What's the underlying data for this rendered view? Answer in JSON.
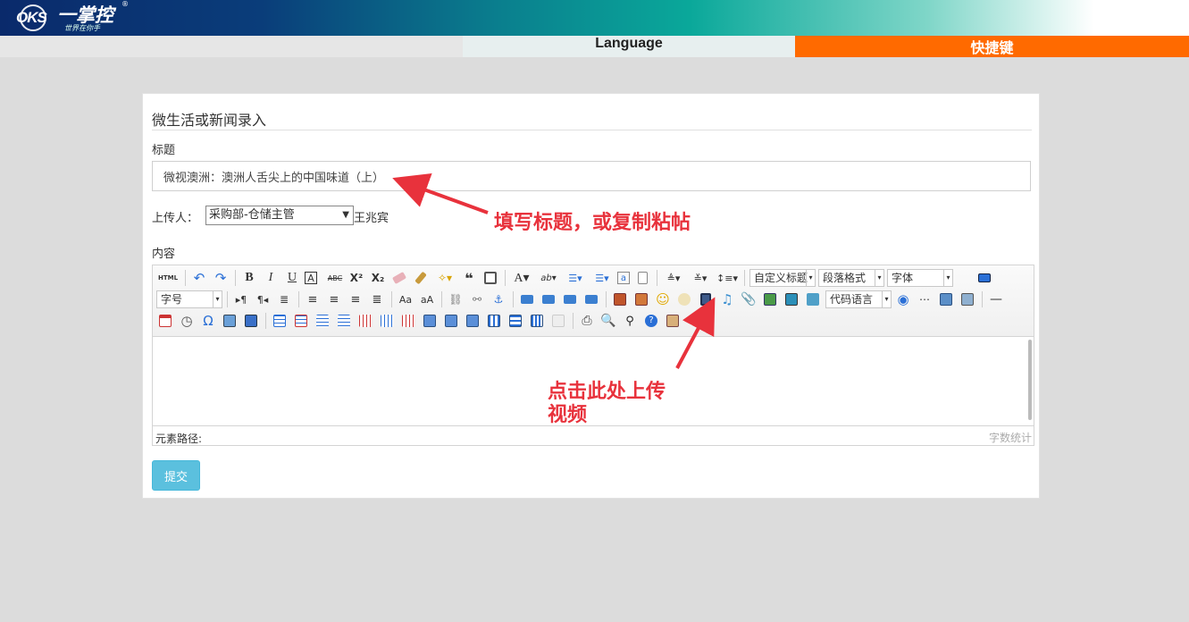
{
  "header": {
    "logo_text": "一掌控",
    "logo_mark": "OKS",
    "logo_slogan": "世界在你手",
    "logo_reg": "®",
    "brand_colors": [
      "#0a2a6b",
      "#0aa89a",
      "#ffffff"
    ]
  },
  "nav": {
    "language_label": "Language",
    "hotkey_label": "快捷键",
    "hotkey_color": "#ff6a00"
  },
  "form": {
    "title": "微生活或新闻录入",
    "title_label": "标题",
    "title_value": "微视澳洲：澳洲人舌尖上的中国味道（上）",
    "uploader_label": "上传人：",
    "uploader_selected": "采购部-仓储主管",
    "uploader_name": "王兆宾",
    "content_label": "内容",
    "submit_label": "提交",
    "submit_color": "#5bc0de"
  },
  "editor": {
    "dropdowns": {
      "custom_title": "自定义标题",
      "paragraph": "段落格式",
      "font": "字体",
      "font_size": "字号",
      "code_lang": "代码语言"
    },
    "status_path_label": "元素路径:",
    "word_count_label": "字数统计"
  },
  "annotations": {
    "fill_title": "填写标题，或复制粘帖",
    "upload_video_line1": "点击此处上传",
    "upload_video_line2": "视频",
    "color": "#e8323c"
  }
}
